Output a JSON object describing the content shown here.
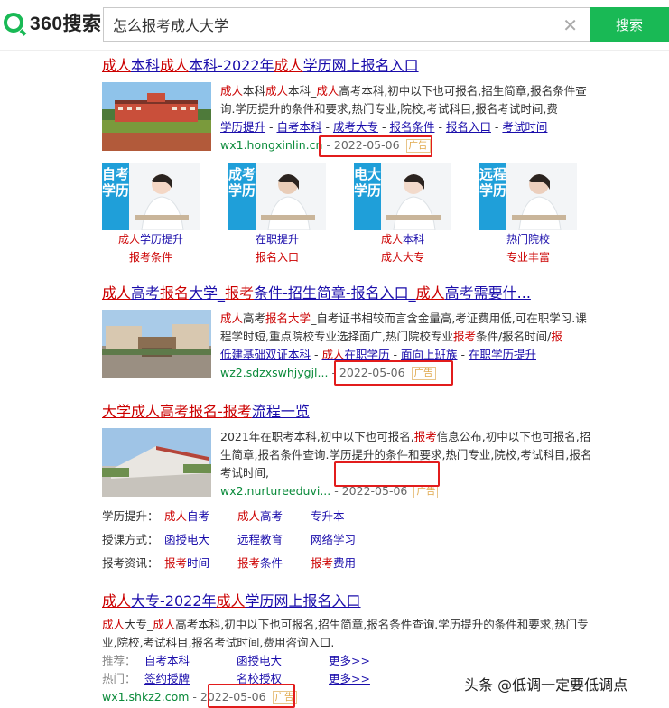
{
  "header": {
    "logo_text": "360搜索",
    "search_value": "怎么报考成人大学",
    "search_button": "搜索"
  },
  "result1": {
    "title_parts": [
      {
        "text": "成人",
        "hl": true
      },
      {
        "text": "本科",
        "hl": false
      },
      {
        "text": "成人",
        "hl": true
      },
      {
        "text": "本科-2022年",
        "hl": false
      },
      {
        "text": "成人",
        "hl": true
      },
      {
        "text": "学历网上报名入口",
        "hl": false
      }
    ],
    "desc_parts": [
      {
        "text": "成人",
        "hl": true
      },
      {
        "text": "本科",
        "hl": false
      },
      {
        "text": "成人",
        "hl": true
      },
      {
        "text": "本科_",
        "hl": false
      },
      {
        "text": "成人",
        "hl": true
      },
      {
        "text": "高考本科,初中以下也可报名,招生简章,报名条件查询.学历提升的条件和要求,热门专业,院校,考试科目,报名考试时间,费",
        "hl": false
      }
    ],
    "links": [
      "学历提升",
      "自考本科",
      "成考大专",
      "报名条件",
      "报名入口",
      "考试时间"
    ],
    "url": "wx1.hongxinlin.cn",
    "date": "2022-05-06",
    "ad": "广告"
  },
  "tiles": [
    {
      "tag": "自考学历",
      "line1_parts": [
        {
          "text": "成人",
          "hl": true
        },
        {
          "text": "学历提升",
          "hl": false
        }
      ],
      "line2": "报考条件"
    },
    {
      "tag": "成考学历",
      "line1_parts": [
        {
          "text": "在职提升",
          "hl": false
        }
      ],
      "line2": "报名入口"
    },
    {
      "tag": "电大学历",
      "line1_parts": [
        {
          "text": "成人",
          "hl": true
        },
        {
          "text": "本科",
          "hl": false
        }
      ],
      "line2": "成人大专"
    },
    {
      "tag": "远程学历",
      "line1_parts": [
        {
          "text": "热门院校",
          "hl": false
        }
      ],
      "line2": "专业丰富"
    }
  ],
  "result2": {
    "title_parts": [
      {
        "text": "成人",
        "hl": true
      },
      {
        "text": "高考",
        "hl": false
      },
      {
        "text": "报名",
        "hl": true
      },
      {
        "text": "大学_",
        "hl": false
      },
      {
        "text": "报考",
        "hl": true
      },
      {
        "text": "条件-招生简章-报名入口_",
        "hl": false
      },
      {
        "text": "成人",
        "hl": true
      },
      {
        "text": "高考需要什...",
        "hl": false
      }
    ],
    "desc_parts": [
      {
        "text": "成人",
        "hl": true
      },
      {
        "text": "高考",
        "hl": false
      },
      {
        "text": "报名",
        "hl": true
      },
      {
        "text": "大学",
        "hl": true
      },
      {
        "text": "_自考证书相较而言含金量高,考证费用低,可在职学习.课程学时短,重点院校专业选择面广,热门院校专业",
        "hl": false
      },
      {
        "text": "报考",
        "hl": true
      },
      {
        "text": "条件/报名时间/",
        "hl": false
      },
      {
        "text": "报",
        "hl": true
      }
    ],
    "links_parts": [
      {
        "text": "低建基础双证本科",
        "hl": false
      },
      {
        "text": "成人",
        "hl": true
      },
      {
        "text": "在职学历",
        "hl": false
      },
      {
        "text": "面向上班族",
        "hl": false
      },
      {
        "text": "在职学历提升",
        "hl": false
      }
    ],
    "url": "wz2.sdzxswhjygjl...",
    "date": "2022-05-06",
    "ad": "广告"
  },
  "result3": {
    "title_parts": [
      {
        "text": "大学",
        "hl": true
      },
      {
        "text": "成人",
        "hl": true
      },
      {
        "text": "高考报名-",
        "hl": true
      },
      {
        "text": "报考",
        "hl": true
      },
      {
        "text": "流程一览",
        "hl": false
      }
    ],
    "desc_parts": [
      {
        "text": "2021年在职考本科,初中以下也可报名,",
        "hl": false
      },
      {
        "text": "报考",
        "hl": true
      },
      {
        "text": "信息公布,初中以下也可报名,招生简章,报名条件查询.学历提升的条件和要求,热门专业,院校,考试科目,报名考试时间,",
        "hl": false
      }
    ],
    "url": "wx2.nurtureeduvi...",
    "date": "2022-05-06",
    "ad": "广告"
  },
  "categories": [
    {
      "label": "学历提升：",
      "items": [
        [
          {
            "text": "成人",
            "hl": true
          },
          {
            "text": "自考",
            "hl": false
          }
        ],
        [
          {
            "text": "成人",
            "hl": true
          },
          {
            "text": "高考",
            "hl": false
          }
        ],
        [
          {
            "text": "专升本",
            "hl": false
          }
        ]
      ]
    },
    {
      "label": "授课方式：",
      "items": [
        [
          {
            "text": "函授电大",
            "hl": false
          }
        ],
        [
          {
            "text": "远程教育",
            "hl": false
          }
        ],
        [
          {
            "text": "网络学习",
            "hl": false
          }
        ]
      ]
    },
    {
      "label": "报考资讯：",
      "items": [
        [
          {
            "text": "报考",
            "hl": true
          },
          {
            "text": "时间",
            "hl": false
          }
        ],
        [
          {
            "text": "报考",
            "hl": true
          },
          {
            "text": "条件",
            "hl": false
          }
        ],
        [
          {
            "text": "报考",
            "hl": true
          },
          {
            "text": "费用",
            "hl": false
          }
        ]
      ]
    }
  ],
  "result4": {
    "title_parts": [
      {
        "text": "成人",
        "hl": true
      },
      {
        "text": "大专-2022年",
        "hl": false
      },
      {
        "text": "成人",
        "hl": true
      },
      {
        "text": "学历网上报名入口",
        "hl": false
      }
    ],
    "desc_parts": [
      {
        "text": "成人",
        "hl": true
      },
      {
        "text": "大专_",
        "hl": false
      },
      {
        "text": "成人",
        "hl": true
      },
      {
        "text": "高考本科,初中以下也可报名,招生简章,报名条件查询.学历提升的条件和要求,热门专业,院校,考试科目,报名考试时间,费用咨询入口.",
        "hl": false
      }
    ],
    "rec_label": "推荐：",
    "rec_items": [
      "自考本科",
      "函授电大",
      "更多>>"
    ],
    "hot_label": "热门：",
    "hot_items": [
      "签约授牌",
      "名校授权",
      "更多>>"
    ],
    "url": "wx1.shkz2.com",
    "date": "2022-05-06",
    "ad": "广告"
  },
  "watermark": "头条 @低调一定要低调点"
}
